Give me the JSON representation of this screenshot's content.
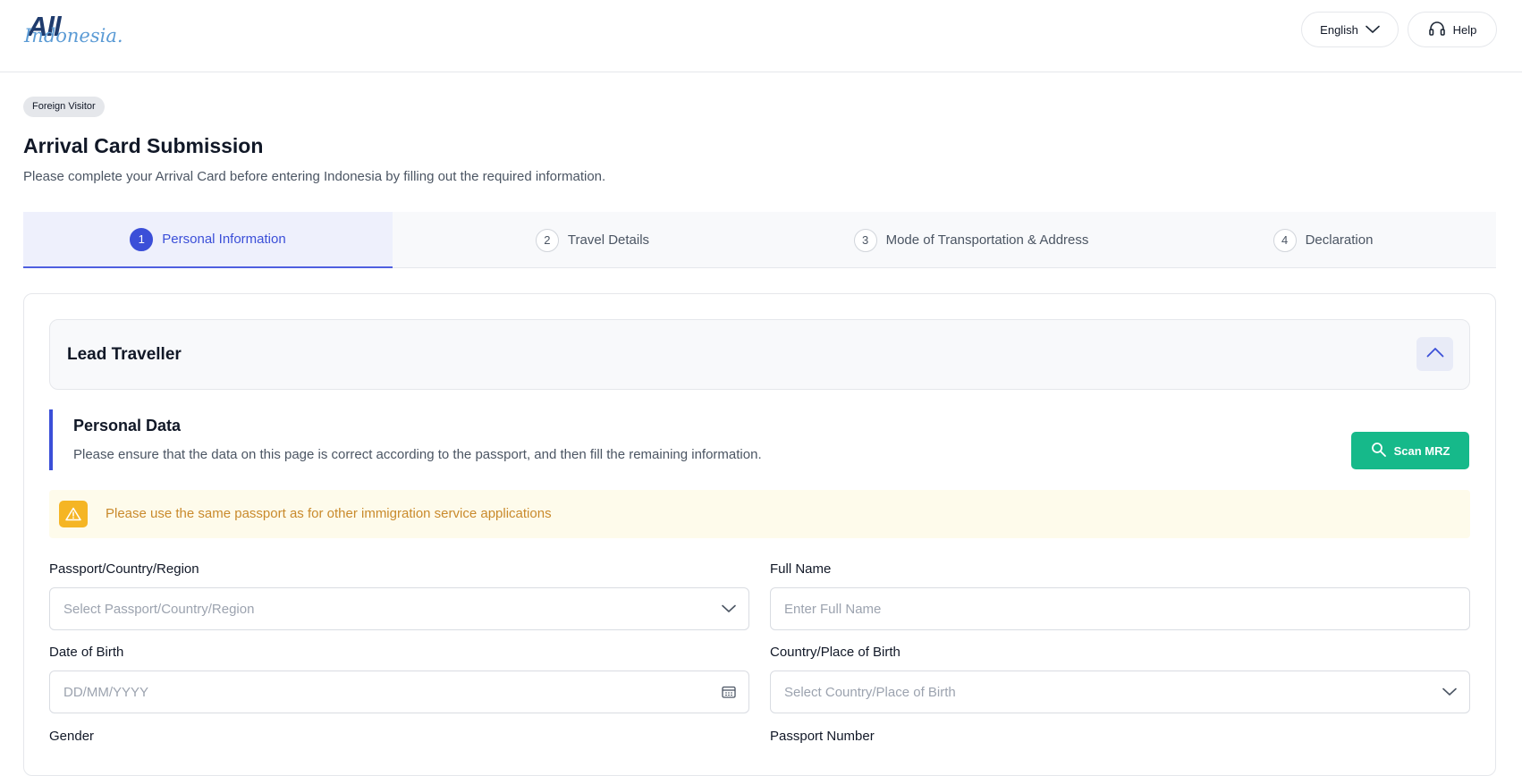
{
  "header": {
    "logo_primary": "All",
    "logo_secondary": "Indonesia.",
    "language_label": "English",
    "help_label": "Help"
  },
  "page": {
    "badge": "Foreign Visitor",
    "title": "Arrival Card Submission",
    "subtitle": "Please complete your Arrival Card before entering Indonesia by filling out the required information."
  },
  "steps": [
    {
      "num": "1",
      "label": "Personal Information",
      "active": true
    },
    {
      "num": "2",
      "label": "Travel Details",
      "active": false
    },
    {
      "num": "3",
      "label": "Mode of Transportation & Address",
      "active": false
    },
    {
      "num": "4",
      "label": "Declaration",
      "active": false
    }
  ],
  "accordion": {
    "title": "Lead Traveller",
    "toggle_icon": "chevron-up-icon"
  },
  "section": {
    "title": "Personal Data",
    "description": "Please ensure that the data on this page is correct according to the passport, and then fill the remaining information.",
    "scan_button": "Scan MRZ"
  },
  "alert": {
    "text": "Please use the same passport as for other immigration service applications",
    "icon": "warning-icon"
  },
  "form": {
    "passport_country": {
      "label": "Passport/Country/Region",
      "placeholder": "Select Passport/Country/Region"
    },
    "full_name": {
      "label": "Full Name",
      "placeholder": "Enter Full Name"
    },
    "date_of_birth": {
      "label": "Date of Birth",
      "placeholder": "DD/MM/YYYY"
    },
    "place_of_birth": {
      "label": "Country/Place of Birth",
      "placeholder": "Select Country/Place of Birth"
    },
    "gender": {
      "label": "Gender"
    },
    "passport_number": {
      "label": "Passport Number"
    }
  },
  "colors": {
    "accent": "#3b4fd8",
    "scan_button": "#16b98a",
    "alert_bg": "#fefbeb",
    "alert_text": "#c98a2c",
    "alert_icon_bg": "#f5b524"
  }
}
